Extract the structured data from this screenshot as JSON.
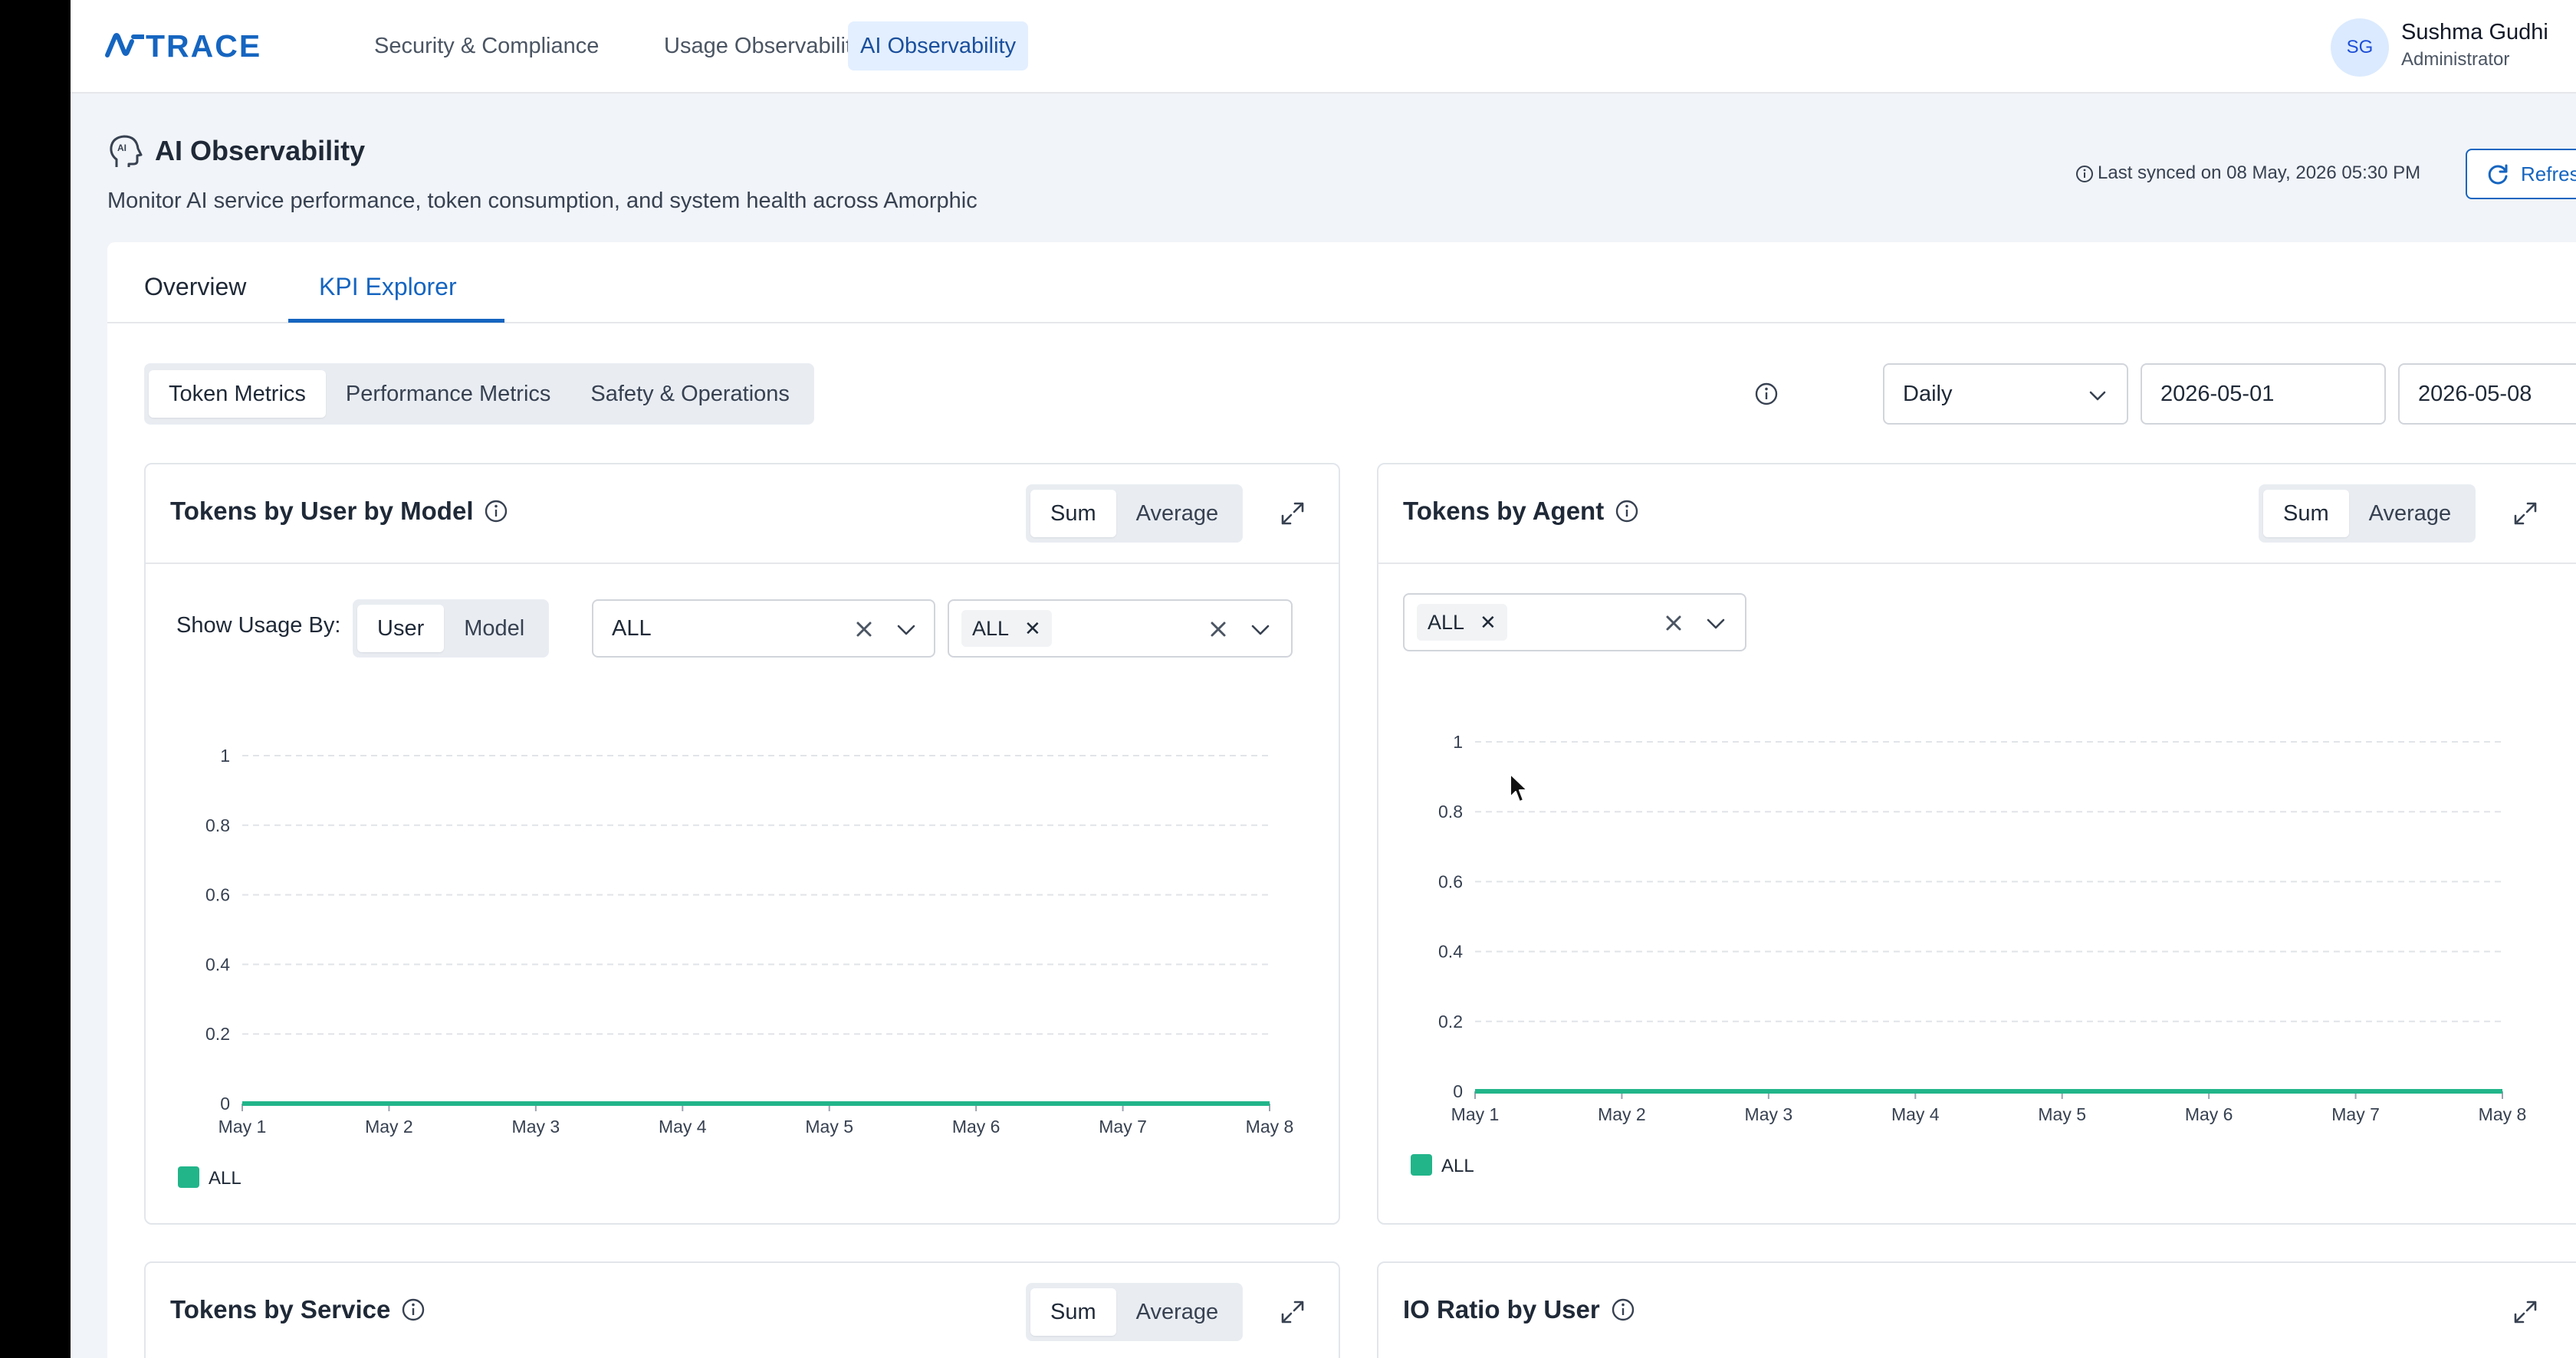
{
  "brand": {
    "logo_text": "TRACE",
    "accent": "#1565c0"
  },
  "nav": {
    "items": [
      {
        "label": "Security & Compliance",
        "active": false
      },
      {
        "label": "Usage Observability",
        "active": false
      },
      {
        "label": "AI Observability",
        "active": true
      }
    ]
  },
  "user": {
    "initials": "SG",
    "name": "Sushma Gudhi",
    "role": "Administrator"
  },
  "page": {
    "title": "AI Observability",
    "subtitle": "Monitor AI service performance, token consumption, and system health across Amorphic",
    "last_synced": "Last synced on 08 May, 2026 05:30 PM",
    "refresh_label": "Refresh"
  },
  "tabs": [
    {
      "label": "Overview",
      "active": false
    },
    {
      "label": "KPI Explorer",
      "active": true
    }
  ],
  "metric_tabs": [
    {
      "label": "Token Metrics",
      "active": true
    },
    {
      "label": "Performance Metrics",
      "active": false
    },
    {
      "label": "Safety & Operations",
      "active": false
    }
  ],
  "filters": {
    "granularity": "Daily",
    "start_date": "2026-05-01",
    "end_date": "2026-05-08"
  },
  "panels": {
    "user_model": {
      "title": "Tokens by User by Model",
      "agg": {
        "sum": "Sum",
        "average": "Average",
        "selected": "Sum"
      },
      "show_usage_label": "Show Usage By:",
      "usage_toggle": {
        "user": "User",
        "model": "Model",
        "selected": "User"
      },
      "select_user": "ALL",
      "select_model_chip": "ALL"
    },
    "agent": {
      "title": "Tokens by Agent",
      "agg": {
        "sum": "Sum",
        "average": "Average",
        "selected": "Sum"
      },
      "select_agent_chip": "ALL"
    },
    "service": {
      "title": "Tokens by Service",
      "agg": {
        "sum": "Sum",
        "average": "Average",
        "selected": "Sum"
      }
    },
    "io_ratio": {
      "title": "IO Ratio by User"
    }
  },
  "chart_data": [
    {
      "type": "line",
      "x": [
        "May 1",
        "May 2",
        "May 3",
        "May 4",
        "May 5",
        "May 6",
        "May 7",
        "May 8"
      ],
      "series": [
        {
          "name": "ALL",
          "values": [
            0,
            0,
            0,
            0,
            0,
            0,
            0,
            0
          ],
          "color": "#22b58a"
        }
      ],
      "yticks": [
        "0",
        "0.2",
        "0.4",
        "0.6",
        "0.8",
        "1"
      ],
      "ylim": [
        0,
        1
      ],
      "grid": true,
      "legend": "bottom-left"
    },
    {
      "type": "line",
      "x": [
        "May 1",
        "May 2",
        "May 3",
        "May 4",
        "May 5",
        "May 6",
        "May 7",
        "May 8"
      ],
      "series": [
        {
          "name": "ALL",
          "values": [
            0,
            0,
            0,
            0,
            0,
            0,
            0,
            0
          ],
          "color": "#22b58a"
        }
      ],
      "yticks": [
        "0",
        "0.2",
        "0.4",
        "0.6",
        "0.8",
        "1"
      ],
      "ylim": [
        0,
        1
      ],
      "grid": true,
      "legend": "bottom-left"
    }
  ]
}
